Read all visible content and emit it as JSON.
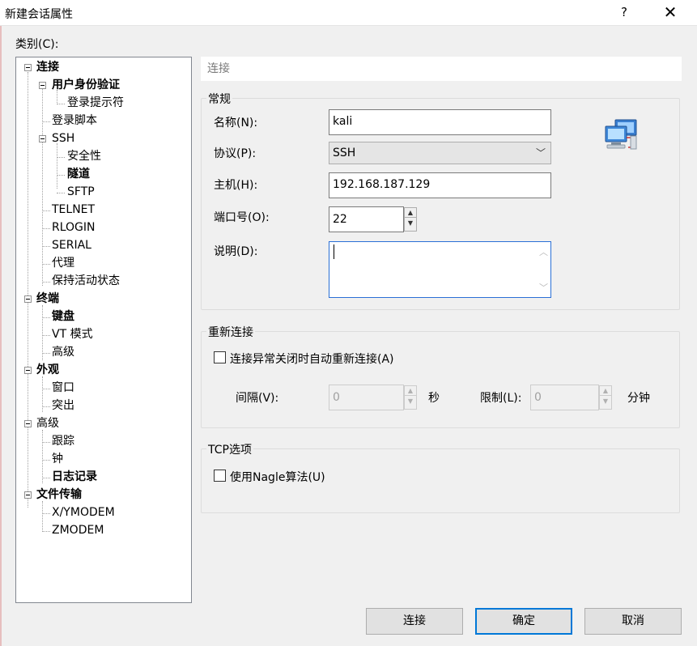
{
  "window": {
    "title": "新建会话属性",
    "help_glyph": "?",
    "close_glyph": "✕"
  },
  "category_label": "类别(C):",
  "tree": [
    {
      "label": "连接",
      "bold": true
    },
    {
      "label": "用户身份验证",
      "bold": true
    },
    {
      "label": "登录提示符",
      "bold": false
    },
    {
      "label": "登录脚本",
      "bold": false
    },
    {
      "label": "SSH",
      "bold": false
    },
    {
      "label": "安全性",
      "bold": false
    },
    {
      "label": "隧道",
      "bold": true
    },
    {
      "label": "SFTP",
      "bold": false
    },
    {
      "label": "TELNET",
      "bold": false
    },
    {
      "label": "RLOGIN",
      "bold": false
    },
    {
      "label": "SERIAL",
      "bold": false
    },
    {
      "label": "代理",
      "bold": false
    },
    {
      "label": "保持活动状态",
      "bold": false
    },
    {
      "label": "终端",
      "bold": true
    },
    {
      "label": "键盘",
      "bold": true
    },
    {
      "label": "VT 模式",
      "bold": false
    },
    {
      "label": "高级",
      "bold": false
    },
    {
      "label": "外观",
      "bold": true
    },
    {
      "label": "窗口",
      "bold": false
    },
    {
      "label": "突出",
      "bold": false
    },
    {
      "label": "高级",
      "bold": false
    },
    {
      "label": "跟踪",
      "bold": false
    },
    {
      "label": "钟",
      "bold": false
    },
    {
      "label": "日志记录",
      "bold": true
    },
    {
      "label": "文件传输",
      "bold": true
    },
    {
      "label": "X/YMODEM",
      "bold": false
    },
    {
      "label": "ZMODEM",
      "bold": false
    }
  ],
  "section_header": "连接",
  "general": {
    "title": "常规",
    "name_label": "名称(N):",
    "name_value": "kali",
    "protocol_label": "协议(P):",
    "protocol_value": "SSH",
    "host_label": "主机(H):",
    "host_value": "192.168.187.129",
    "port_label": "端口号(O):",
    "port_value": "22",
    "desc_label": "说明(D):",
    "desc_value": ""
  },
  "reconnect": {
    "title": "重新连接",
    "auto_label": "连接异常关闭时自动重新连接(A)",
    "auto_checked": false,
    "interval_label": "间隔(V):",
    "interval_value": "0",
    "interval_unit": "秒",
    "limit_label": "限制(L):",
    "limit_value": "0",
    "limit_unit": "分钟"
  },
  "tcp": {
    "title": "TCP选项",
    "nagle_label": "使用Nagle算法(U)",
    "nagle_checked": false
  },
  "buttons": {
    "connect": "连接",
    "ok": "确定",
    "cancel": "取消"
  },
  "icons": {
    "network": "network-computers-icon",
    "spin_up": "▲",
    "spin_down": "▼",
    "chevron": "﹀",
    "scroll_up": "︿",
    "scroll_down": "﹀"
  },
  "colors": {
    "focus_border": "#0078d7"
  }
}
